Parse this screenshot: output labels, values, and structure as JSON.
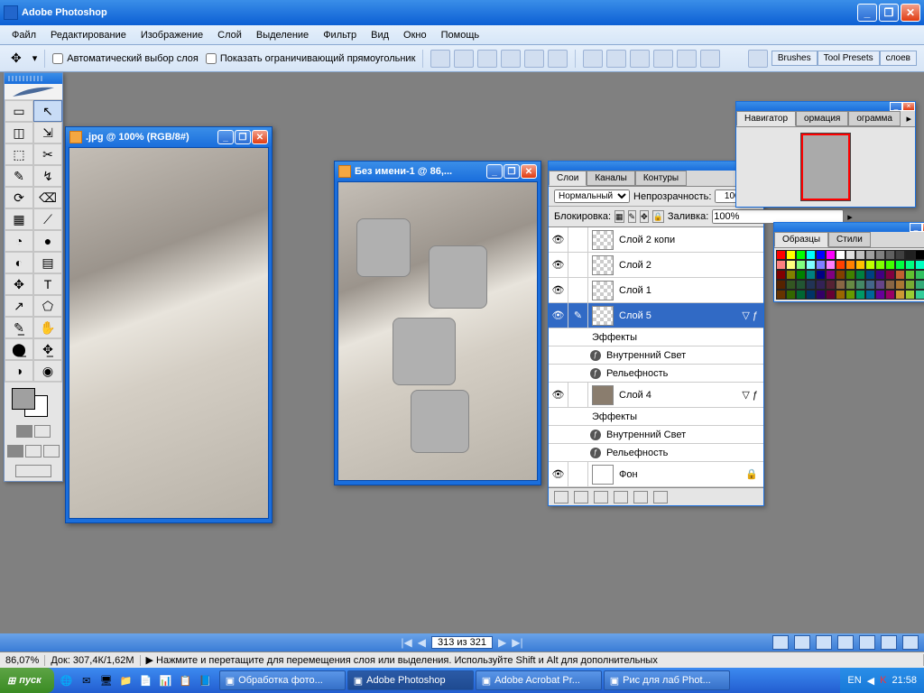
{
  "app": {
    "title": "Adobe Photoshop"
  },
  "menu": [
    "Файл",
    "Редактирование",
    "Изображение",
    "Слой",
    "Выделение",
    "Фильтр",
    "Вид",
    "Окно",
    "Помощь"
  ],
  "toolbar": {
    "auto_select": "Автоматический выбор слоя",
    "show_bounds": "Показать ограничивающий прямоугольник",
    "right_tabs": [
      "Brushes",
      "Tool Presets",
      "слоев"
    ]
  },
  "tools": [
    "▭",
    "↖",
    "◫",
    "⇲",
    "⬚",
    "✂",
    "✎",
    "↯",
    "⟳",
    "⌫",
    "▦",
    "⟋",
    "◔",
    "●",
    "◐",
    "▤",
    "✥",
    "T",
    "↗",
    "⬠",
    "✎̲",
    "✋",
    "⬤̲",
    "✥̲",
    "◑",
    "◉"
  ],
  "doc1": {
    "title": ".jpg @ 100% (RGB/8#)"
  },
  "doc2": {
    "title": "Без имени-1 @ 86,..."
  },
  "layers_panel": {
    "tabs": [
      "Слои",
      "Каналы",
      "Контуры"
    ],
    "mode": "Нормальный",
    "opacity_label": "Непрозрачность:",
    "opacity": "100%",
    "lock_label": "Блокировка:",
    "fill_label": "Заливка:",
    "fill": "100%",
    "layers": [
      {
        "name": "Слой 2 копи",
        "sel": false
      },
      {
        "name": "Слой 2",
        "sel": false
      },
      {
        "name": "Слой 1",
        "sel": false
      },
      {
        "name": "Слой 5",
        "sel": true,
        "fx": true
      },
      {
        "name": "Эффекты",
        "sub": true
      },
      {
        "name": "Внутренний Свет",
        "sub": true,
        "dot": true
      },
      {
        "name": "Рельефность",
        "sub": true,
        "dot": true
      },
      {
        "name": "Слой 4",
        "sel": false,
        "fx": true,
        "filled": true
      },
      {
        "name": "Эффекты",
        "sub": true
      },
      {
        "name": "Внутренний Свет",
        "sub": true,
        "dot": true
      },
      {
        "name": "Рельефность",
        "sub": true,
        "dot": true
      },
      {
        "name": "Фон",
        "sel": false,
        "white": true,
        "lock": true
      }
    ]
  },
  "navigator": {
    "tabs": [
      "Навигатор",
      "ормация",
      "ограмма"
    ]
  },
  "swatches": {
    "tabs": [
      "Образцы",
      "Стили"
    ]
  },
  "swatch_colors": [
    "#ff0000",
    "#ffff00",
    "#00ff00",
    "#00ffff",
    "#0000ff",
    "#ff00ff",
    "#ffffff",
    "#e0e0e0",
    "#c0c0c0",
    "#a0a0a0",
    "#808080",
    "#606060",
    "#404040",
    "#202020",
    "#000000",
    "#400000",
    "#ff8080",
    "#ffff80",
    "#80ff80",
    "#80ffff",
    "#8080ff",
    "#ff80ff",
    "#ff4000",
    "#ff8000",
    "#ffc000",
    "#c0ff00",
    "#80ff00",
    "#40ff00",
    "#00ff40",
    "#00ff80",
    "#00ffc0",
    "#00c0ff",
    "#800000",
    "#808000",
    "#008000",
    "#008080",
    "#000080",
    "#800080",
    "#804000",
    "#408000",
    "#008040",
    "#004080",
    "#400080",
    "#800040",
    "#c06030",
    "#60c030",
    "#30c060",
    "#3060c0",
    "#552200",
    "#335522",
    "#225533",
    "#223355",
    "#332255",
    "#552233",
    "#886644",
    "#668844",
    "#448866",
    "#446688",
    "#664488",
    "#886644",
    "#aa7733",
    "#77aa33",
    "#33aa77",
    "#3377aa",
    "#663300",
    "#336600",
    "#006633",
    "#003366",
    "#330066",
    "#660033",
    "#996600",
    "#669900",
    "#009966",
    "#006699",
    "#660099",
    "#990066",
    "#cc9933",
    "#99cc33",
    "#33cc99",
    "#3399cc"
  ],
  "status": {
    "zoom": "86,07%",
    "doc": "Док: 307,4К/1,62М",
    "hint": "Нажмите и перетащите для перемещения слоя или выделения. Используйте Shift и Alt для дополнительных"
  },
  "pager": {
    "info": "313 из 321"
  },
  "taskbar": {
    "start": "пуск",
    "tasks": [
      {
        "label": "Обработка фото...",
        "active": false
      },
      {
        "label": "Adobe Photoshop",
        "active": true
      },
      {
        "label": "Adobe Acrobat Pr...",
        "active": false
      },
      {
        "label": "Рис для лаб Phot...",
        "active": false
      }
    ],
    "lang": "EN",
    "time": "21:58"
  }
}
